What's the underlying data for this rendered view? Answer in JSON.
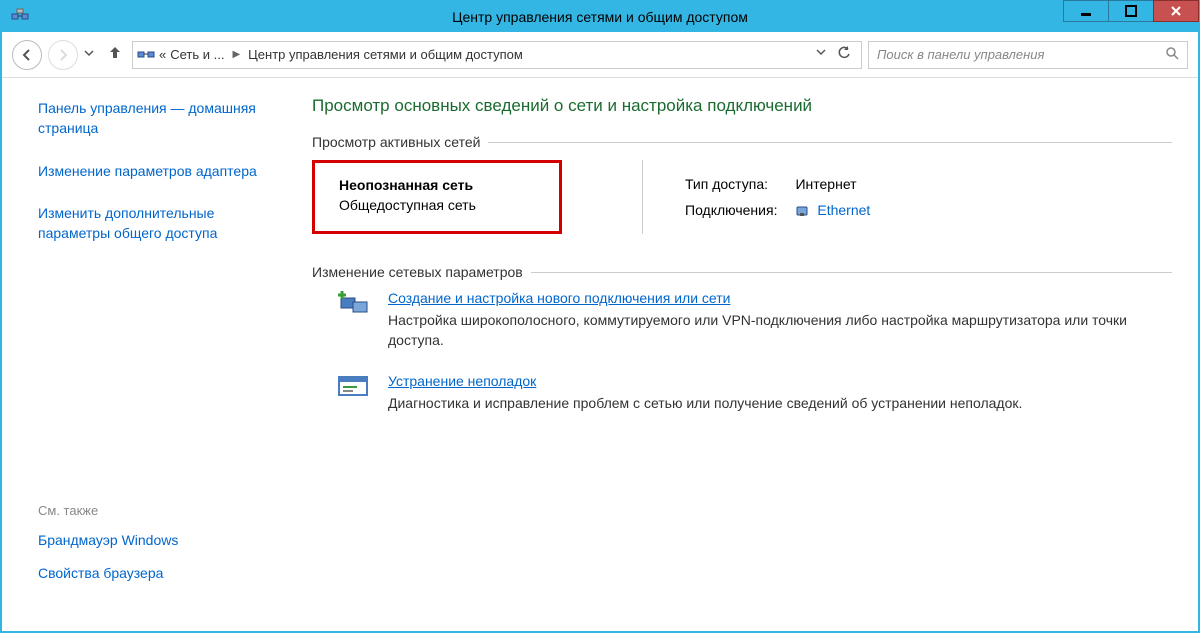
{
  "window": {
    "title": "Центр управления сетями и общим доступом"
  },
  "toolbar": {
    "breadcrumb_1": "Сеть и ...",
    "breadcrumb_2": "Центр управления сетями и общим доступом",
    "caret_left": "«",
    "search_placeholder": "Поиск в панели управления"
  },
  "sidebar": {
    "home_link": "Панель управления — домашняя страница",
    "adapter_link": "Изменение параметров адаптера",
    "sharing_link": "Изменить дополнительные параметры общего доступа",
    "see_also_label": "См. также",
    "firewall_link": "Брандмауэр Windows",
    "browser_link": "Свойства браузера"
  },
  "main": {
    "heading": "Просмотр основных сведений о сети и настройка подключений",
    "active_networks_label": "Просмотр активных сетей",
    "network": {
      "name": "Неопознанная сеть",
      "type": "Общедоступная сеть",
      "access_type_label": "Тип доступа:",
      "access_type_value": "Интернет",
      "connections_label": "Подключения:",
      "connections_value": "Ethernet"
    },
    "change_settings_label": "Изменение сетевых параметров",
    "task1": {
      "title": "Создание и настройка нового подключения или сети",
      "desc": "Настройка широкополосного, коммутируемого или VPN-подключения либо настройка маршрутизатора или точки доступа."
    },
    "task2": {
      "title": "Устранение неполадок",
      "desc": "Диагностика и исправление проблем с сетью или получение сведений об устранении неполадок."
    }
  }
}
